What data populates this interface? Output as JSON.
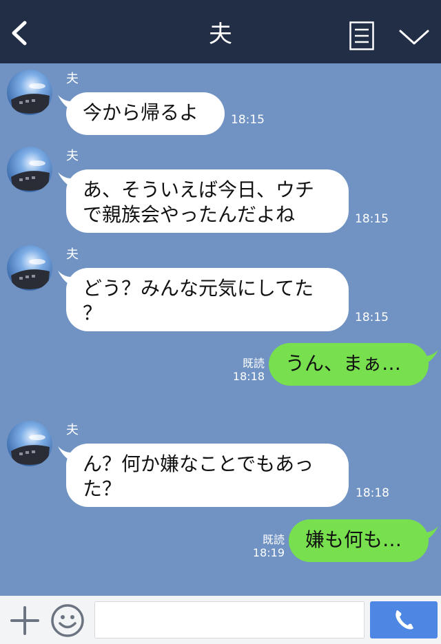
{
  "header": {
    "title": "夫",
    "back_icon": "chevron-left-icon",
    "notes_icon": "notes-icon",
    "menu_icon": "chevron-down-icon"
  },
  "messages": [
    {
      "sender": "夫",
      "lines": [
        "今から帰るよ"
      ],
      "time": "18:15"
    },
    {
      "sender": "夫",
      "lines": [
        "あ、そういえば今日、ウチ",
        "で親族会やったんだよね"
      ],
      "time": "18:15"
    },
    {
      "sender": "夫",
      "lines": [
        "どう？みんな元気にしてた",
        "？"
      ],
      "time": "18:15"
    },
    {
      "lines": [
        "うん、まぁ…"
      ],
      "read": "既読",
      "time": "18:18"
    },
    {
      "sender": "夫",
      "lines": [
        "ん？何か嫌なことでもあっ",
        "た？"
      ],
      "time": "18:18"
    },
    {
      "lines": [
        "嫌も何も…"
      ],
      "read": "既読",
      "time": "18:19"
    }
  ],
  "footer": {
    "input_value": "",
    "plus_icon": "plus-icon",
    "emoji_icon": "emoji-icon",
    "call_icon": "phone-icon"
  },
  "colors": {
    "header_bg": "#222d46",
    "chat_bg": "#7093c3",
    "outgoing_bubble": "#78e04f",
    "incoming_bubble": "#ffffff",
    "call_button": "#4e86e4"
  }
}
